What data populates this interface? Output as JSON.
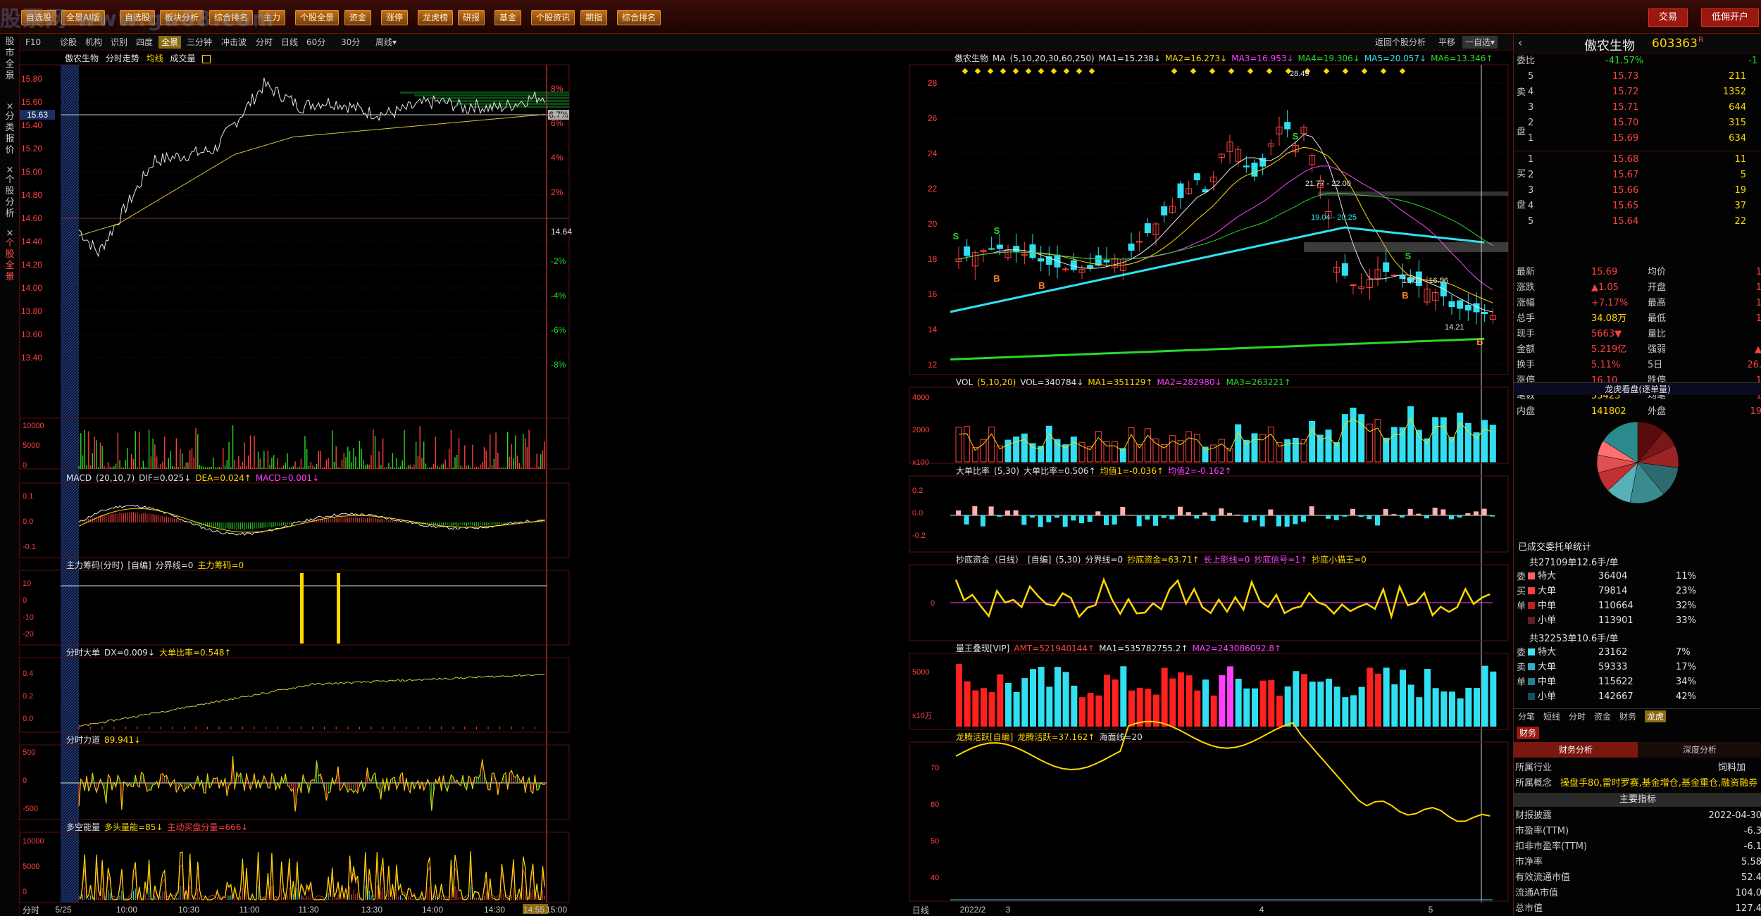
{
  "window": {
    "title": "",
    "logo_text": "股票网 www.gu68.com"
  },
  "menu": [
    "自选股",
    "全景AI版",
    "自选股",
    "板块分析",
    "综合排名",
    "主力",
    "个股全景",
    "资金",
    "涨停",
    "龙虎榜",
    "研报",
    "基金",
    "个股资讯",
    "期指",
    "综合排名"
  ],
  "menu_right": {
    "trade": "交易",
    "open_account": "低佣开户"
  },
  "toolbar": {
    "left": [
      "F10",
      "诊股",
      "机构",
      "识别",
      "四度",
      "全景",
      "三分钟",
      "冲击波",
      "分时",
      "日线",
      "60分",
      "30分",
      "周线▾"
    ],
    "active": "全景",
    "right": [
      "返回个股分析",
      "平移",
      "一自选▾"
    ]
  },
  "leftnav": [
    "股市全景",
    "分类报价",
    "个股分析",
    "个股全景"
  ],
  "stock": {
    "name": "傲农生物",
    "code": "603363",
    "flag": "R"
  },
  "intraday": {
    "header": [
      "傲农生物",
      "分时走势",
      "均线",
      "成交量"
    ],
    "price_ticks": [
      "15.80",
      "15.60",
      "15.40",
      "15.20",
      "15.00",
      "14.80",
      "14.60",
      "14.40",
      "14.20",
      "14.00",
      "13.80",
      "13.60",
      "13.40"
    ],
    "pct_ticks": [
      "8%",
      "6%",
      "4%",
      "2%",
      "",
      "-2%",
      "-4%",
      "-6%",
      "-8%"
    ],
    "cur_price": "15.63",
    "cur_pct": "6.7%",
    "ref_price": "14.64",
    "vol_ticks": [
      "10000",
      "5000",
      "0"
    ],
    "time_ticks": [
      "5/25",
      "10:00",
      "10:30",
      "11:00",
      "11:30",
      "13:30",
      "14:00",
      "14:30",
      "14:55",
      "15:00"
    ],
    "bottom_label": "分时",
    "macd": {
      "label": "MACD",
      "params": "(20,10,7)",
      "dif": "DIF=0.025↓",
      "dea": "DEA=0.024↑",
      "macd": "MACD=0.001↓",
      "ticks": [
        "0.1",
        "0.0",
        "-0.1"
      ]
    },
    "zlcm": {
      "label": "主力筹码(分时)",
      "tag": "[自编]",
      "l1": "分界线=0",
      "l2": "主力筹码=0",
      "ticks": [
        "10",
        "0",
        "-10",
        "-20"
      ]
    },
    "fsdd": {
      "label": "分时大单",
      "dx": "DX=0.009↓",
      "ratio": "大单比率=0.548↑",
      "ticks": [
        "0.4",
        "0.2",
        "0.0"
      ]
    },
    "fsld": {
      "label": "分时力道",
      "val": "89.941↓",
      "ticks": [
        "500",
        "0",
        "-500"
      ]
    },
    "dkn": {
      "label": "多空能量",
      "v1": "多头量能=85↓",
      "v2": "主动买盘分量=666↓",
      "ticks": [
        "10000",
        "5000",
        "0"
      ]
    }
  },
  "daily": {
    "header": {
      "name": "傲农生物",
      "ma": "MA",
      "params": "(5,10,20,30,60,250)",
      "ma1": "MA1=15.238↓",
      "ma2": "MA2=16.273↓",
      "ma3": "MA3=16.953↓",
      "ma4": "MA4=19.306↓",
      "ma5": "MA5=20.057↓",
      "ma6": "MA6=13.346↑"
    },
    "price_ticks": [
      "28",
      "26",
      "24",
      "22",
      "20",
      "18",
      "16",
      "14",
      "12"
    ],
    "annotations": [
      "28.49",
      "21.77 - 22.00",
      "19.04 - 20.25",
      "15.53 - 16.56",
      "14.21"
    ],
    "signals": [
      "S",
      "B"
    ],
    "vol": {
      "label": "VOL",
      "params": "(5,10,20)",
      "v": "VOL=340784↓",
      "ma1": "MA1=351129↑",
      "ma2": "MA2=282980↓",
      "ma3": "MA3=263221↑",
      "ticks": [
        "4000",
        "2000",
        "x100"
      ]
    },
    "ddbl": {
      "label": "大单比率",
      "params": "(5,30)",
      "v1": "大单比率=0.506↑",
      "v2": "均值1=-0.036↑",
      "v3": "均值2=-0.162↑",
      "ticks": [
        "0.2",
        "0.0",
        "-0.2"
      ]
    },
    "cdzj": {
      "label": "抄底资金（日线）",
      "tag": "[自编]",
      "params": "(5,30)",
      "v1": "分界线=0",
      "v2": "抄底资金=63.71↑",
      "v3": "长上影线=0",
      "v4": "抄底信号=1↑",
      "v5": "抄底小猫王=0",
      "ticks": [
        "0"
      ]
    },
    "lwdx": {
      "label": "量王叠现[VIP]",
      "amt": "AMT=521940144↑",
      "ma1": "MA1=535782755.2↑",
      "ma2": "MA2=243086092.8↑",
      "ticks": [
        "5000",
        "x10万"
      ]
    },
    "lthy": {
      "label": "龙腾活跃[自编]",
      "v1": "龙腾活跃=37.162↑",
      "v2": "海面线=20",
      "ticks": [
        "70",
        "60",
        "50",
        "40"
      ]
    },
    "time_ticks": [
      "2022/2",
      "3",
      "4",
      "5"
    ],
    "bottom_label": "日线"
  },
  "quote": {
    "committee": {
      "label": "委比",
      "pct": "-41.57%",
      "diff": "-1"
    },
    "sell": [
      [
        "5",
        "15.73",
        "211"
      ],
      [
        "4",
        "15.72",
        "1352"
      ],
      [
        "3",
        "15.71",
        "644"
      ],
      [
        "2",
        "15.70",
        "315"
      ],
      [
        "1",
        "15.69",
        "634"
      ]
    ],
    "buy": [
      [
        "1",
        "15.68",
        "11"
      ],
      [
        "2",
        "15.67",
        "5"
      ],
      [
        "3",
        "15.66",
        "19"
      ],
      [
        "4",
        "15.65",
        "37"
      ],
      [
        "5",
        "15.64",
        "22"
      ]
    ],
    "side_sell": "卖",
    "side_buy": "买",
    "side_pan": "盘",
    "stats": [
      [
        "最新",
        "15.69",
        "均价",
        "1"
      ],
      [
        "涨跌",
        "▲1.05",
        "开盘",
        "1"
      ],
      [
        "涨幅",
        "+7.17%",
        "最高",
        "1"
      ],
      [
        "总手",
        "34.08万",
        "最低",
        "1"
      ],
      [
        "现手",
        "5663▼",
        "量比",
        ""
      ],
      [
        "金额",
        "5.219亿",
        "强弱",
        "▲"
      ],
      [
        "换手",
        "5.11%",
        "5日",
        "26."
      ],
      [
        "涨停",
        "16.10",
        "跌停",
        "1"
      ],
      [
        "笔数",
        "55423",
        "均笔",
        "1"
      ],
      [
        "内盘",
        "141802",
        "外盘",
        "19"
      ]
    ],
    "pie_title": "龙虎看盘(逐单量)",
    "pie_colors": [
      "#5a0c0c",
      "#7a1818",
      "#9a2424",
      "#2c6a70",
      "#3a8a90",
      "#5ab0b8",
      "#c03030",
      "#e05050",
      "#ff7070",
      "#2a8a8c"
    ],
    "entrust_title": "已成交委托单统计",
    "buy_total": "共27109单12.6手/单",
    "buy_rows": [
      [
        "特大",
        "36404",
        "11%"
      ],
      [
        "大单",
        "79814",
        "23%"
      ],
      [
        "中单",
        "110664",
        "32%"
      ],
      [
        "小单",
        "113901",
        "33%"
      ]
    ],
    "buy_side": [
      "委",
      "买",
      "单"
    ],
    "sell_total": "共32253单10.6手/单",
    "sell_rows": [
      [
        "特大",
        "23162",
        "7%"
      ],
      [
        "大单",
        "59333",
        "17%"
      ],
      [
        "中单",
        "115622",
        "34%"
      ],
      [
        "小单",
        "142667",
        "42%"
      ]
    ],
    "sell_side": [
      "委",
      "卖",
      "单"
    ],
    "tabs": [
      "分笔",
      "短线",
      "分时",
      "资金",
      "财务",
      "龙虎"
    ],
    "fin_tab": "财务",
    "fin_subtabs": [
      "财务分析",
      "深度分析"
    ],
    "industry": {
      "label": "所属行业",
      "value": "饲料加"
    },
    "concept": {
      "label": "所属概念",
      "value": "操盘手80,雷时罗赛,基金增仓,基金重仓,融资融券"
    },
    "main_title": "主要指标",
    "metrics": [
      [
        "财报披露",
        "2022-04-30"
      ],
      [
        "市盈率(TTM)",
        "-6.3"
      ],
      [
        "扣非市盈率(TTM)",
        "-6.1"
      ],
      [
        "市净率",
        "5.58"
      ],
      [
        "有效流通市值",
        "52.4"
      ],
      [
        "流通A市值",
        "104.0"
      ],
      [
        "总市值",
        "127.4"
      ]
    ]
  }
}
